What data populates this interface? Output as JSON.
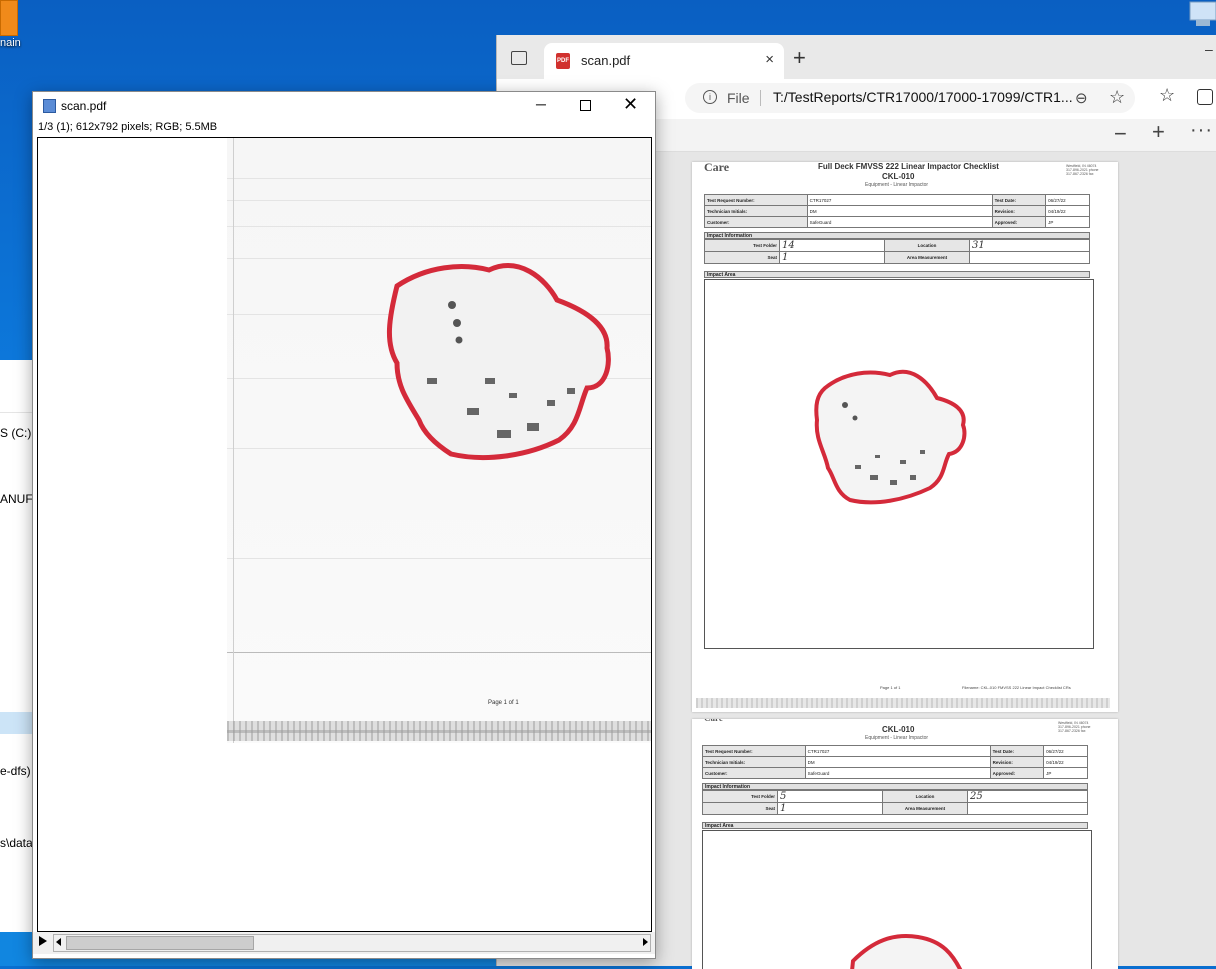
{
  "desktop": {
    "icon_label": "nain"
  },
  "explorer": {
    "drive_c": "S (C:)",
    "manufacturer": "ANUFA",
    "dfs": "e-dfs) (",
    "data_path": "s\\data"
  },
  "browser": {
    "tab_title": "scan.pdf",
    "tab_icon": "PDF",
    "address_scheme": "File",
    "address_url": "T:/TestReports/CTR17000/17000-17099/CTR1...",
    "new_tab": "+",
    "close_tab": "×"
  },
  "pdf_page1": {
    "logo": "Care",
    "title": "Full Deck FMVSS 222 Linear Impactor Checklist",
    "doc_id": "CKL-010",
    "subtitle": "Equipment - Linear Impactor",
    "address": "Westfield, IN 46074\n317-896-2021 phone\n317-867-2326 fax",
    "labels": {
      "test_request_number": "Test Request Number:",
      "technician_initials": "Technician Initials:",
      "customer": "Customer:",
      "test_date": "Test Date:",
      "revision": "Revision:",
      "approved": "Approved:",
      "impact_information": "Impact Information",
      "test_folder": "Test Folder",
      "location": "Location",
      "seat": "Seat",
      "area_measurement": "Area Measurement",
      "impact_area": "Impact Area"
    },
    "values": {
      "test_request_number": "CTR17027",
      "technician_initials": "DM",
      "customer": "SafeGuard",
      "test_date": "06/27/22",
      "revision": "04/19/22",
      "approved": "JP",
      "test_folder": "14",
      "location": "31",
      "seat": "1"
    },
    "footer_page": "Page 1 of 1",
    "footer_file": "Filename: CKL-010 FMVSS 222 Linear Impact Checklist CRs"
  },
  "pdf_page2": {
    "title": "CKL-010",
    "subtitle": "Equipment - Linear Impactor",
    "address": "Westfield, IN 46074\n317-896-2021 phone\n317-867-2326 fax",
    "values": {
      "test_request_number": "CTR17027",
      "technician_initials": "DM",
      "customer": "SafeGuard",
      "test_date": "06/27/22",
      "revision": "04/19/22",
      "approved": "JP",
      "test_folder": "5",
      "location": "25",
      "seat": "1"
    }
  },
  "image_viewer": {
    "title": "scan.pdf",
    "info": "1/3 (1); 612x792 pixels; RGB; 5.5MB",
    "page_footer": "Page 1 of 1",
    "minimize": "─",
    "close": "✕"
  },
  "colors": {
    "desktop_blue": "#0d79dc",
    "outline_red": "#d42a3a",
    "pdf_red": "#d1312e"
  }
}
